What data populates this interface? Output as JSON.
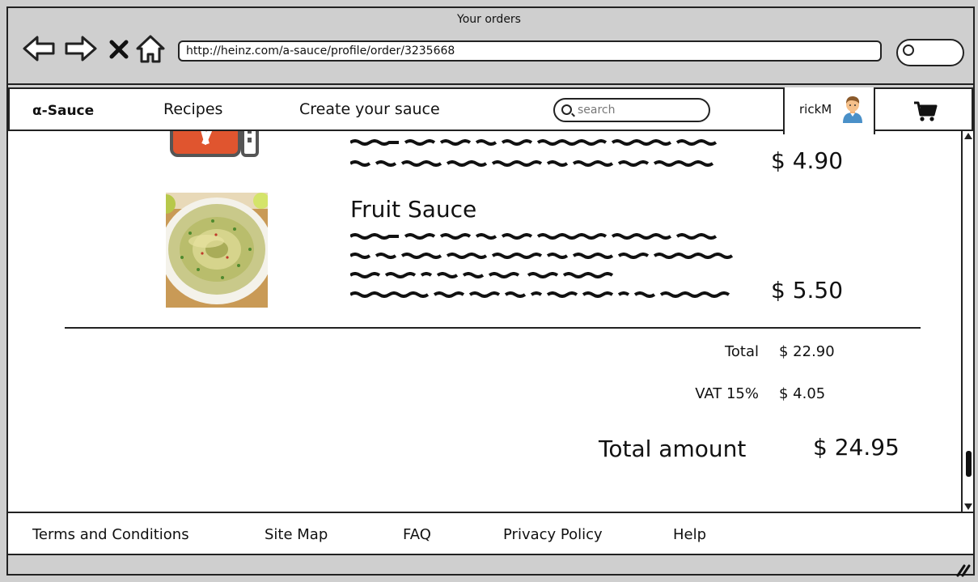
{
  "window": {
    "title": "Your orders"
  },
  "browser": {
    "url": "http://heinz.com/a-sauce/profile/order/3235668"
  },
  "site": {
    "logo": "α-Sauce",
    "nav": [
      "Recipes",
      "Create your sauce"
    ],
    "search_placeholder": "search",
    "username": "rickM"
  },
  "order": {
    "items": [
      {
        "name": "",
        "price": "$ 4.90"
      },
      {
        "name": "Fruit Sauce",
        "price": "$ 5.50"
      }
    ],
    "total_label": "Total",
    "total_value": "$ 22.90",
    "vat_label": "VAT 15%",
    "vat_value": "$ 4.05",
    "grand_label": "Total amount",
    "grand_value": "$ 24.95"
  },
  "footer": [
    "Terms and Conditions",
    "Site Map",
    "FAQ",
    "Privacy Policy",
    "Help"
  ],
  "icons": {
    "back": "arrow-left-icon",
    "forward": "arrow-right-icon",
    "stop": "close-icon",
    "home": "home-icon",
    "search": "search-icon",
    "cart": "cart-icon",
    "avatar": "user-avatar-icon"
  }
}
